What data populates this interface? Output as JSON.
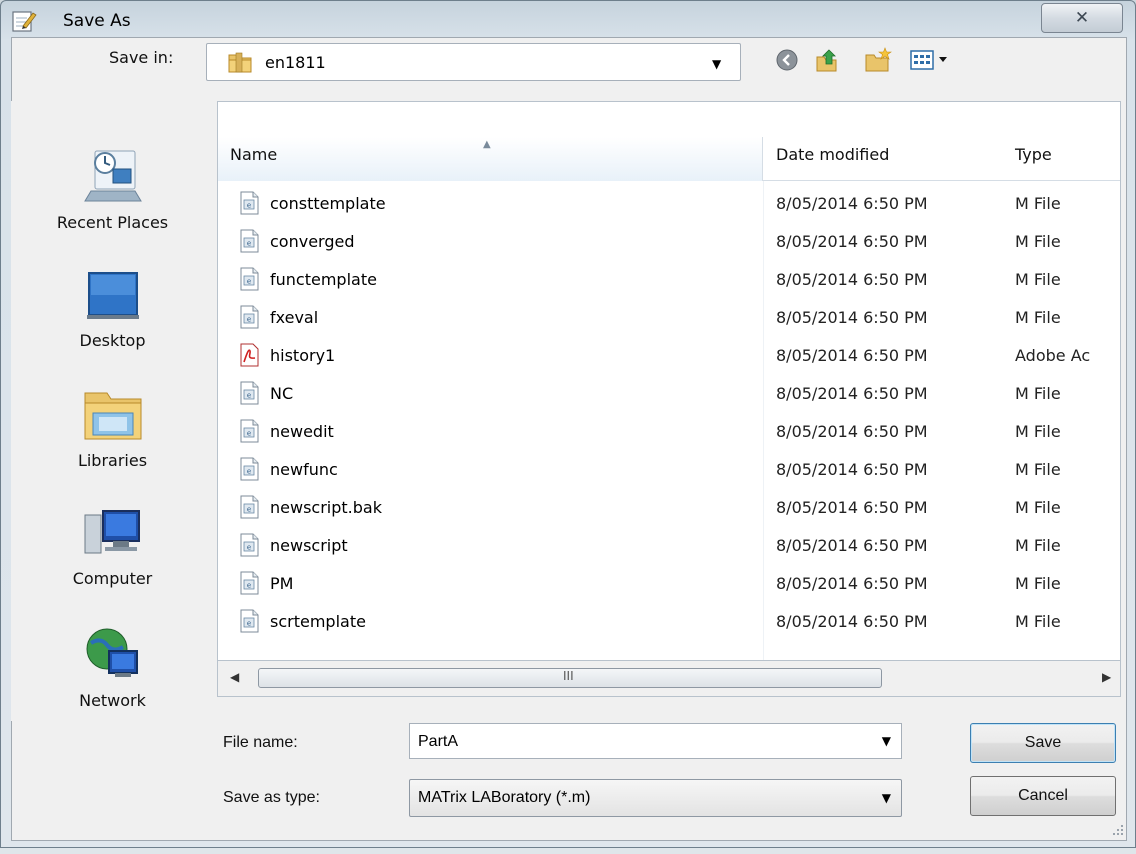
{
  "window": {
    "title": "Save As",
    "close_symbol": "✕"
  },
  "save_in": {
    "label": "Save in:",
    "value": "en1811",
    "arrow": "▼"
  },
  "toolbar": {
    "icons": [
      "back-icon",
      "up-folder-icon",
      "new-folder-icon",
      "view-menu-icon"
    ]
  },
  "places": [
    {
      "label": "Recent Places",
      "icon": "recent-places-icon"
    },
    {
      "label": "Desktop",
      "icon": "desktop-icon"
    },
    {
      "label": "Libraries",
      "icon": "libraries-icon"
    },
    {
      "label": "Computer",
      "icon": "computer-icon"
    },
    {
      "label": "Network",
      "icon": "network-icon"
    }
  ],
  "columns": {
    "name": "Name",
    "date": "Date modified",
    "type": "Type",
    "sort_arrow": "▲"
  },
  "files": [
    {
      "name": "consttemplate",
      "date": "8/05/2014 6:50 PM",
      "type": "M File",
      "icon": "m-file-icon"
    },
    {
      "name": "converged",
      "date": "8/05/2014 6:50 PM",
      "type": "M File",
      "icon": "m-file-icon"
    },
    {
      "name": "functemplate",
      "date": "8/05/2014 6:50 PM",
      "type": "M File",
      "icon": "m-file-icon"
    },
    {
      "name": "fxeval",
      "date": "8/05/2014 6:50 PM",
      "type": "M File",
      "icon": "m-file-icon"
    },
    {
      "name": "history1",
      "date": "8/05/2014 6:50 PM",
      "type": "Adobe Ac",
      "icon": "pdf-file-icon"
    },
    {
      "name": "NC",
      "date": "8/05/2014 6:50 PM",
      "type": "M File",
      "icon": "m-file-icon"
    },
    {
      "name": "newedit",
      "date": "8/05/2014 6:50 PM",
      "type": "M File",
      "icon": "m-file-icon"
    },
    {
      "name": "newfunc",
      "date": "8/05/2014 6:50 PM",
      "type": "M File",
      "icon": "m-file-icon"
    },
    {
      "name": "newscript.bak",
      "date": "8/05/2014 6:50 PM",
      "type": "M File",
      "icon": "m-file-icon"
    },
    {
      "name": "newscript",
      "date": "8/05/2014 6:50 PM",
      "type": "M File",
      "icon": "m-file-icon"
    },
    {
      "name": "PM",
      "date": "8/05/2014 6:50 PM",
      "type": "M File",
      "icon": "m-file-icon"
    },
    {
      "name": "scrtemplate",
      "date": "8/05/2014 6:50 PM",
      "type": "M File",
      "icon": "m-file-icon"
    }
  ],
  "scrollbar": {
    "left_arrow": "◀",
    "right_arrow": "▶",
    "grip": "III"
  },
  "file_name": {
    "label": "File name:",
    "value": "PartA",
    "arrow": "▼"
  },
  "save_as_type": {
    "label": "Save as type:",
    "value": "MATrix LABoratory (*.m)",
    "arrow": "▼"
  },
  "buttons": {
    "save": "Save",
    "cancel": "Cancel"
  },
  "colors": {
    "accent": "#3c7fb1",
    "selection_header": "#e8f1f9"
  }
}
